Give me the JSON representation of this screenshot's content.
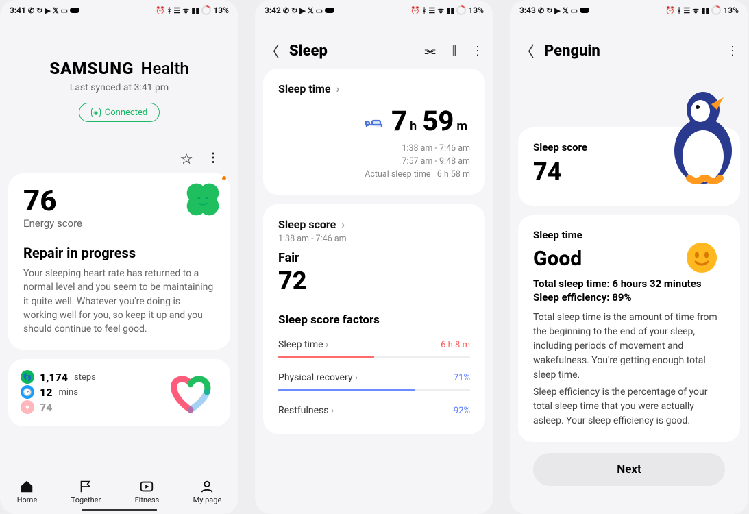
{
  "status": {
    "time1": "3:41",
    "time2": "3:42",
    "time3": "3:43",
    "battery": "13%"
  },
  "screen1": {
    "brand1": "SAMSUNG",
    "brand2": "Health",
    "synced": "Last synced at 3:41 pm",
    "connected": "Connected",
    "energy_score": "76",
    "energy_label": "Energy score",
    "repair_title": "Repair in progress",
    "repair_body": "Your sleeping heart rate has returned to a normal level and you seem to be maintaining it quite well. Whatever you're doing is working well for you, so keep it up and you should continue to feel good.",
    "steps_val": "1,174",
    "steps_unit": "steps",
    "mins_val": "12",
    "mins_unit": "mins",
    "third_val": "74",
    "nav": {
      "home": "Home",
      "together": "Together",
      "fitness": "Fitness",
      "mypage": "My page"
    }
  },
  "screen2": {
    "title": "Sleep",
    "sleep_time_label": "Sleep time",
    "hours": "7",
    "h": "h",
    "mins": "59",
    "m": "m",
    "range1": "1:38 am - 7:46 am",
    "range2": "7:57 am - 9:48 am",
    "actual_label": "Actual sleep time",
    "actual_val": "6 h 58 m",
    "score_label": "Sleep score",
    "score_range": "1:38 am - 7:46 am",
    "fair": "Fair",
    "score_val": "72",
    "factors_title": "Sleep score factors",
    "f1_name": "Sleep time",
    "f1_val": "6 h 8 m",
    "f2_name": "Physical recovery",
    "f2_val": "71%",
    "f3_name": "Restfulness",
    "f3_val": "92%"
  },
  "screen3": {
    "title": "Penguin",
    "ss_label": "Sleep score",
    "ss_val": "74",
    "st_label": "Sleep time",
    "good": "Good",
    "total_line": "Total sleep time: 6 hours 32 minutes",
    "eff_line": "Sleep efficiency: 89%",
    "body1": "Total sleep time is the amount of time from the beginning to the end of your sleep, including periods of movement and wakefulness. You're getting enough total sleep time.",
    "body2": "Sleep efficiency is the percentage of your total sleep time that you were actually asleep. Your sleep efficiency is good.",
    "next": "Next"
  },
  "chart_data": [
    {
      "type": "bar",
      "title": "Sleep score factors",
      "categories": [
        "Sleep time",
        "Physical recovery",
        "Restfulness"
      ],
      "display_values": [
        "6 h 8 m",
        "71%",
        "92%"
      ],
      "percent_fill": [
        50,
        71,
        92
      ],
      "colors": [
        "#ff6b6b",
        "#6b8cff",
        "#6b8cff"
      ]
    }
  ]
}
